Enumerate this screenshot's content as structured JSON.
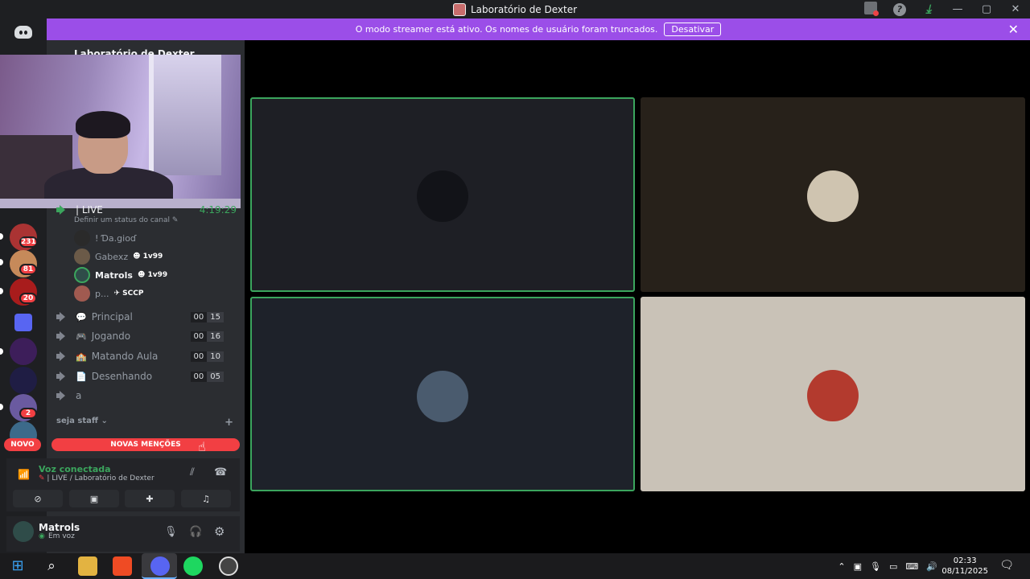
{
  "window": {
    "title": "Laboratório de Dexter"
  },
  "banner": {
    "text": "O modo streamer está ativo. Os nomes de usuário foram truncados.",
    "button": "Desativar"
  },
  "sidebar": {
    "server_name": "Laboratório de Dexter",
    "guild_badges": [
      "231",
      "81",
      "20",
      "2"
    ],
    "live_channel": {
      "name": "| LIVE",
      "timer": "4:19:29",
      "status_prompt": "Definir um status do canal"
    },
    "members": [
      {
        "name": "! Ɗa.gioɗ",
        "tag": ""
      },
      {
        "name": "Gabexz",
        "tag": "1v99"
      },
      {
        "name": "Matrols",
        "tag": "1v99"
      },
      {
        "name": "p...",
        "tag": "SCCP"
      }
    ],
    "channels": [
      {
        "name": "Principal",
        "left": "00",
        "right": "15"
      },
      {
        "name": "Jogando",
        "left": "00",
        "right": "16"
      },
      {
        "name": "Matando Aula",
        "left": "00",
        "right": "10"
      },
      {
        "name": "Desenhando",
        "left": "00",
        "right": "05"
      },
      {
        "name": "a",
        "left": "",
        "right": ""
      }
    ],
    "category": "seja staff",
    "new_label": "NOVO",
    "mentions_label": "NOVAS MENÇÕES"
  },
  "voice": {
    "status": "Voz conectada",
    "channel": "| LIVE / Laboratório de Dexter"
  },
  "user": {
    "name": "Matrols",
    "status": "Em voz"
  },
  "clock": {
    "time": "02:33",
    "date": "08/11/2025"
  }
}
